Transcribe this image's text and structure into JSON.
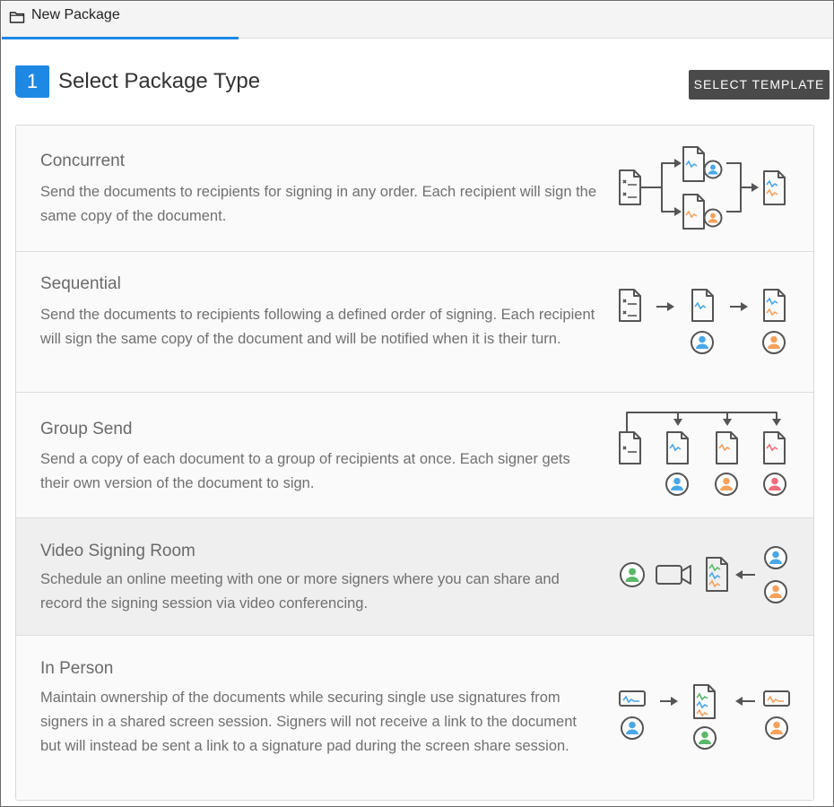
{
  "tab": {
    "label": "New Package",
    "icon": "folder-icon"
  },
  "header": {
    "step_number": "1",
    "title": "Select Package Type",
    "template_button": "SELECT TEMPLATE"
  },
  "colors": {
    "accent": "#1e88e5",
    "button": "#4a4a4a",
    "signer_blue": "#4aa8e8",
    "signer_orange": "#f5a25d",
    "signer_red": "#ee6d7c",
    "signer_green": "#5bb86a",
    "icon_gray": "#555555"
  },
  "options": [
    {
      "title": "Concurrent",
      "description": "Send the documents to recipients for signing in any order. Each recipient will sign the same copy of the document.",
      "icon": "concurrent-flow-icon"
    },
    {
      "title": "Sequential",
      "description": "Send the documents to recipients following a defined order of signing. Each recipient will sign the same copy of the document and will be notified when it is their turn.",
      "icon": "sequential-flow-icon"
    },
    {
      "title": "Group Send",
      "description": "Send a copy of each document to a group of recipients at once. Each signer gets their own version of the document to sign.",
      "icon": "group-send-flow-icon"
    },
    {
      "title": "Video Signing Room",
      "description": "Schedule an online meeting with one or more signers where you can share and record the signing session via video conferencing.",
      "icon": "video-signing-flow-icon"
    },
    {
      "title": "In Person",
      "description": "Maintain ownership of the documents while securing single use signatures from signers in a shared screen session. Signers will not receive a link to the document but will instead be sent a link to a signature pad during the screen share session.",
      "icon": "in-person-flow-icon"
    }
  ]
}
